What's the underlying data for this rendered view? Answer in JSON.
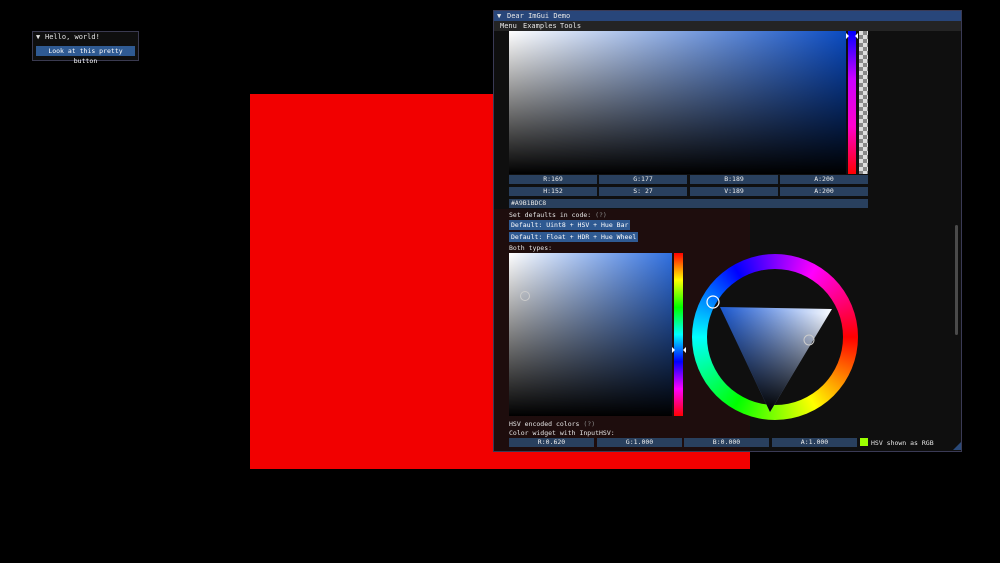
{
  "background_color": "#000000",
  "red_rect_color": "#f20000",
  "hello_window": {
    "collapse_glyph": "▼",
    "title": "Hello, world!",
    "button_label": "Look at this pretty button"
  },
  "demo_window": {
    "collapse_glyph": "▼",
    "title": "Dear ImGui Demo",
    "menu": [
      "Menu",
      "Examples",
      "Tools"
    ],
    "rgba_fields": [
      "R:169",
      "G:177",
      "B:189",
      "A:200"
    ],
    "hsva_fields": [
      "H:152",
      "S: 27",
      "V:189",
      "A:200"
    ],
    "hex_value": "#A9B1BDC8",
    "set_defaults_label": "Set defaults in code:",
    "help_marker": "(?)",
    "default_buttons": [
      "Default: Uint8 + HSV + Hue Bar",
      "Default: Float + HDR + Hue Wheel"
    ],
    "both_types_label": "Both types:",
    "hsv_encoded_label": "HSV encoded colors",
    "inputhsv_label": "Color widget with InputHSV:",
    "float_fields": [
      "R:0.620",
      "G:1.000",
      "B:0.000",
      "A:1.000"
    ],
    "hsv_shown_label": "HSV shown as RGB",
    "swatch_color": "#9bff00"
  }
}
